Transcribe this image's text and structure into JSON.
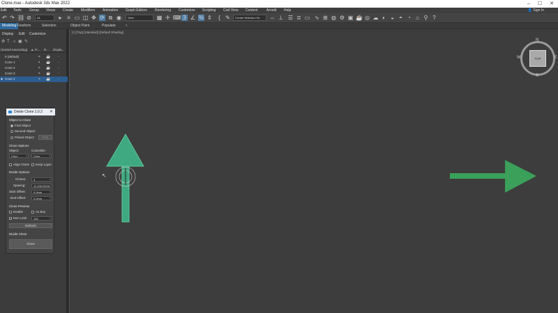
{
  "window": {
    "title": "Clone.max - Autodesk 3ds Max 2022",
    "min": "–",
    "max": "☐",
    "close": "✕"
  },
  "menu": {
    "items": [
      "Edit",
      "Tools",
      "Group",
      "Views",
      "Create",
      "Modifiers",
      "Animation",
      "Graph Editors",
      "Rendering",
      "Customize",
      "Scripting",
      "Civil View",
      "Content",
      "Arnold",
      "Help"
    ],
    "sign_in": "Sign In"
  },
  "toolbar": {
    "selection_filter": "All",
    "reference_coord": "View",
    "named_selection": "Create Selection Se"
  },
  "ribbon": {
    "tabs": [
      "Modeling",
      "Freeform",
      "Selection",
      "Object Paint",
      "Populate"
    ]
  },
  "scene_explorer": {
    "tabs": [
      "Display",
      "Edit",
      "Customize"
    ],
    "headers": {
      "name": "(Sorted Ascending)",
      "frozen": "▲ Fr...",
      "render": "R...",
      "display": "Displa..."
    },
    "rows": [
      {
        "name": "0 (default)",
        "selected": false
      },
      {
        "name": "Cone 1",
        "selected": false
      },
      {
        "name": "Cone 2",
        "selected": false
      },
      {
        "name": "Cone 3",
        "selected": false
      },
      {
        "name": "Cone 4",
        "selected": true
      }
    ]
  },
  "clone_dialog": {
    "title": "Divide Clone 1.0.2",
    "object_to_clone": "Object to Clone",
    "first_object": "First Object",
    "second_object": "Second Object",
    "picked_object": "Picked Object",
    "pick": "Pick",
    "clone_options": "Clone Options",
    "object_label": "Object:",
    "controller_label": "Controller:",
    "object_value": "Copy",
    "controller_value": "Copy",
    "align_clone": "Align Clone",
    "keep_layer": "Keep Layer",
    "divide_options": "Divide Options",
    "clones_label": "Clones:",
    "clones_value": "3",
    "spacing_label": "Spacing:",
    "spacing_value": "11,430.202m",
    "start_offset_label": "Start Offset:",
    "start_offset_value": "0.0mm",
    "end_offset_label": "End Offset:",
    "end_offset_value": "0.0mm",
    "clone_preview": "Clone Preview",
    "enable": "Enable",
    "as_box": "As Box",
    "item_limit": "Item Limit",
    "item_limit_value": "100",
    "refresh": "Refresh",
    "divide_clone": "Divide Clone",
    "clone_button": "Clone"
  },
  "viewport": {
    "label": "[+] [Top] [Standard] [Default Shading]",
    "viewcube": {
      "face": "TOP",
      "n": "N",
      "s": "S",
      "e": "E",
      "w": "W"
    }
  },
  "colors": {
    "arrow_up": "#3fa981",
    "arrow_right": "#3aa05a",
    "selection": "#2c5d8f"
  }
}
